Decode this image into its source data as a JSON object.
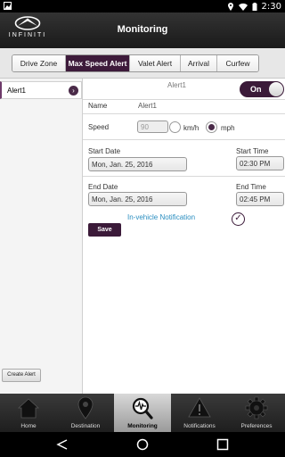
{
  "status": {
    "time": "2:30"
  },
  "header": {
    "brand": "INFINITI",
    "title": "Monitoring"
  },
  "tabs": [
    {
      "label": "Drive Zone",
      "active": false
    },
    {
      "label": "Max Speed Alert",
      "active": true
    },
    {
      "label": "Valet Alert",
      "active": false
    },
    {
      "label": "Arrival",
      "active": false
    },
    {
      "label": "Curfew",
      "active": false
    }
  ],
  "sidebar": {
    "items": [
      {
        "label": "Alert1"
      }
    ],
    "create_label": "Create Alert"
  },
  "form": {
    "alert_title": "Alert1",
    "toggle_label": "On",
    "name_label": "Name",
    "name_value": "Alert1",
    "speed_label": "Speed",
    "speed_value": "90",
    "unit_kmh": "km/h",
    "unit_mph": "mph",
    "selected_unit": "mph",
    "start_date_label": "Start Date",
    "start_date_value": "Mon, Jan. 25, 2016",
    "start_time_label": "Start Time",
    "start_time_value": "02:30 PM",
    "end_date_label": "End Date",
    "end_date_value": "Mon, Jan. 25, 2016",
    "end_time_label": "End Time",
    "end_time_value": "02:45 PM",
    "notification_label": "In-vehicle Notification",
    "notification_checked": true,
    "save_label": "Save"
  },
  "bottom_nav": [
    {
      "label": "Home",
      "icon": "home-icon"
    },
    {
      "label": "Destination",
      "icon": "map-pin-icon"
    },
    {
      "label": "Monitoring",
      "icon": "monitoring-icon",
      "active": true
    },
    {
      "label": "Notifications",
      "icon": "warning-icon"
    },
    {
      "label": "Preferences",
      "icon": "gear-icon"
    }
  ],
  "colors": {
    "accent": "#3b1a39",
    "link": "#2a8ec0"
  }
}
